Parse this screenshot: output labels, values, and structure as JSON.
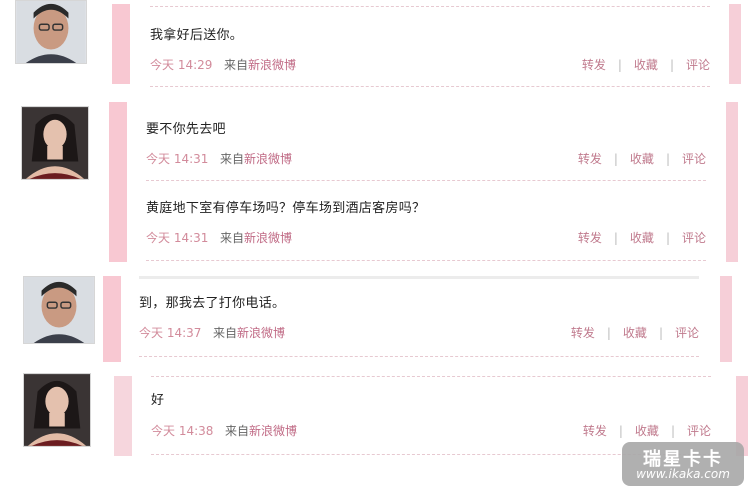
{
  "messages": [
    {
      "text": "我拿好后送你。",
      "time": "今天  14:29",
      "from_prefix": "来自",
      "from_source": "新浪微博",
      "actions": [
        "转发",
        "收藏",
        "评论"
      ]
    },
    {
      "text": "要不你先去吧",
      "time": "今天  14:31",
      "from_prefix": "来自",
      "from_source": "新浪微博",
      "actions": [
        "转发",
        "收藏",
        "评论"
      ]
    },
    {
      "text": "黄庭地下室有停车场吗？停车场到酒店客房吗？",
      "time": "今天  14:31",
      "from_prefix": "来自",
      "from_source": "新浪微博",
      "actions": [
        "转发",
        "收藏",
        "评论"
      ]
    },
    {
      "text": "到，那我去了打你电话。",
      "time": "今天  14:37",
      "from_prefix": "来自",
      "from_source": "新浪微博",
      "actions": [
        "转发",
        "收藏",
        "评论"
      ]
    },
    {
      "text": "好",
      "time": "今天  14:38",
      "from_prefix": "来自",
      "from_source": "新浪微博",
      "actions": [
        "转发",
        "收藏",
        "评论"
      ]
    }
  ],
  "watermark": {
    "title": "瑞星卡卡",
    "url": "www.ikaka.com"
  },
  "colors": {
    "accent_pink": "#f8c8d2",
    "time_color": "#d28b9b",
    "source_link": "#c06a85"
  }
}
